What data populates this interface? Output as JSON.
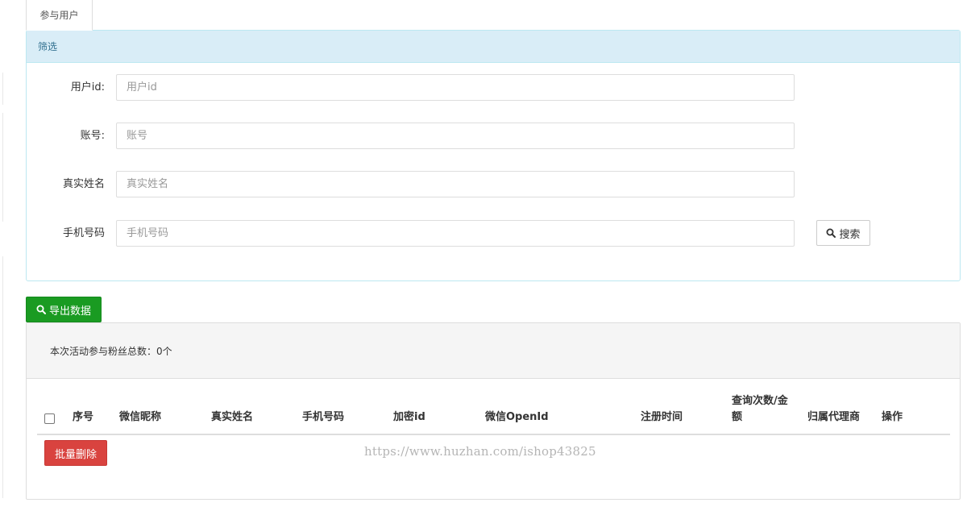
{
  "tab": {
    "label": "参与用户"
  },
  "filter": {
    "heading": "筛选",
    "fields": [
      {
        "label": "用户id:",
        "placeholder": "用户id"
      },
      {
        "label": "账号:",
        "placeholder": "账号"
      },
      {
        "label": "真实姓名",
        "placeholder": "真实姓名"
      },
      {
        "label": "手机号码",
        "placeholder": "手机号码"
      }
    ],
    "search_label": "搜索"
  },
  "toolbar": {
    "export_label": "导出数据"
  },
  "summary": {
    "text": "本次活动参与粉丝总数：0个"
  },
  "table": {
    "columns": [
      "序号",
      "微信昵称",
      "真实姓名",
      "手机号码",
      "加密id",
      "微信OpenId",
      "注册时间",
      "查询次数/金额",
      "归属代理商",
      "操作"
    ],
    "rows": []
  },
  "bulk": {
    "delete_label": "批量删除"
  },
  "watermark": {
    "text": "https://www.huzhan.com/ishop43825"
  },
  "colors": {
    "info_bg": "#d9edf7",
    "info_text": "#31708f",
    "success": "#1a9b22",
    "danger": "#d9433f"
  }
}
